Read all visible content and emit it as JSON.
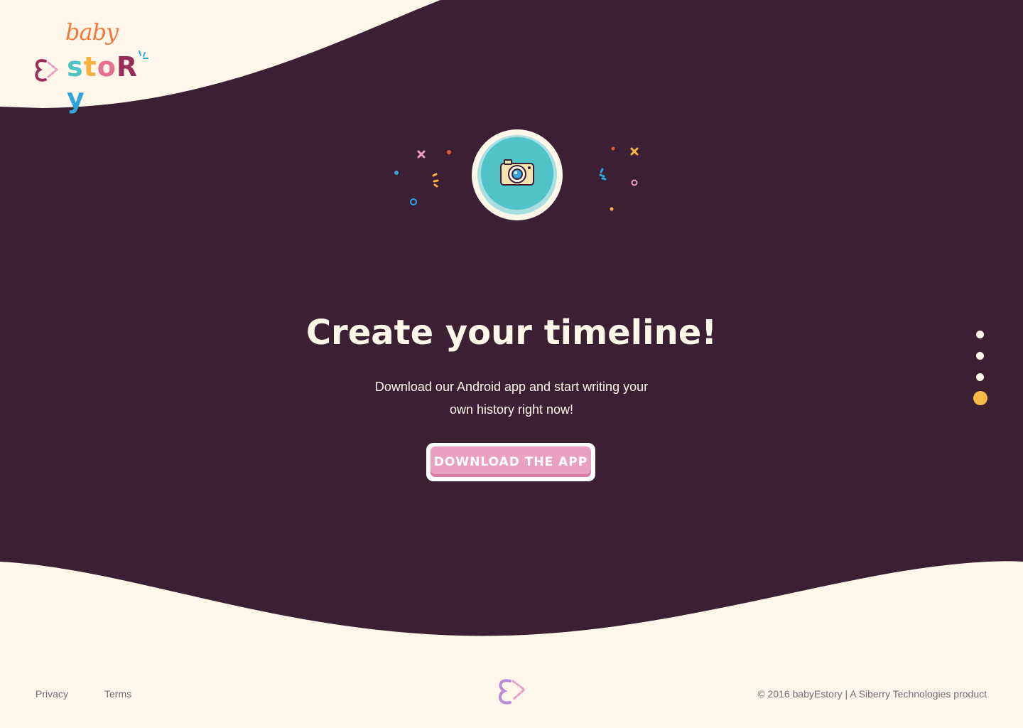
{
  "brand": {
    "logo_top": "baby",
    "logo_bottom": "story",
    "logo_letters": [
      "s",
      "t",
      "o",
      "R",
      "y"
    ],
    "logo_colors": [
      "#4fc3c7",
      "#f6b23e",
      "#e46f8f",
      "#9b2d5a",
      "#2fa6dc"
    ]
  },
  "hero": {
    "icon": "camera-icon",
    "title": "Create your timeline!",
    "subtitle_line1": "Download our Android app and start writing your",
    "subtitle_line2": "own history right now!",
    "cta_label": "DOWNLOAD THE APP"
  },
  "pagination": {
    "total": 4,
    "active_index": 3,
    "active_color": "#fbb945"
  },
  "footer": {
    "privacy": "Privacy",
    "terms": "Terms",
    "copyright": "© 2016 babyEstory | A Siberry Technologies product"
  },
  "colors": {
    "background": "#3c1f33",
    "cream": "#fff6ea",
    "teal": "#4fc3c7",
    "pink": "#e9a1c1",
    "accent": "#fbb945"
  }
}
